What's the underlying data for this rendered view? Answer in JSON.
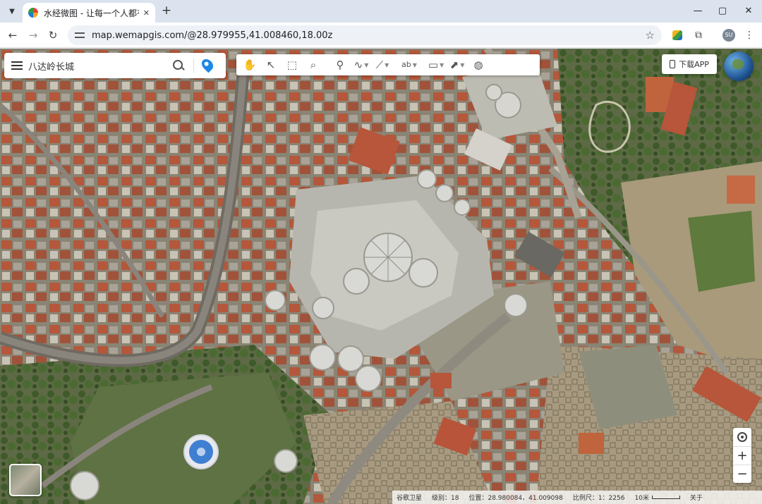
{
  "browser": {
    "tab_title": "水经微图 - 让每一个人都有自己",
    "url": "map.wemapgis.com/@28.979955,41.008460,18.00z",
    "profile_initials": "SU"
  },
  "search": {
    "value": "八达岭长城"
  },
  "tools": [
    {
      "name": "pan-tool",
      "glyph": "✋"
    },
    {
      "name": "select-tool",
      "glyph": "↖"
    },
    {
      "name": "box-select-tool",
      "glyph": "⬚"
    },
    {
      "name": "zoom-area-tool",
      "glyph": "⌕"
    },
    {
      "name": "marker-tool",
      "glyph": "⚲"
    },
    {
      "name": "polyline-tool",
      "glyph": "∿"
    },
    {
      "name": "polygon-tool",
      "glyph": "⟋"
    },
    {
      "name": "text-label-tool",
      "glyph": "ab"
    },
    {
      "name": "measure-tool",
      "glyph": "▭"
    },
    {
      "name": "cursor-tool",
      "glyph": "⬈"
    },
    {
      "name": "globe-tool",
      "glyph": "◍"
    }
  ],
  "download_label": "下载APP",
  "status": {
    "source": "谷歌卫星",
    "level": "级别：18",
    "position": "位置：28.980084，41.009098",
    "scale": "比例尺：1：2256",
    "scale_bar_label": "10米",
    "about": "关于"
  },
  "colors": {
    "accent": "#1e88e5",
    "roof_terracotta": "#b4573b",
    "vegetation": "#4f6b34"
  }
}
